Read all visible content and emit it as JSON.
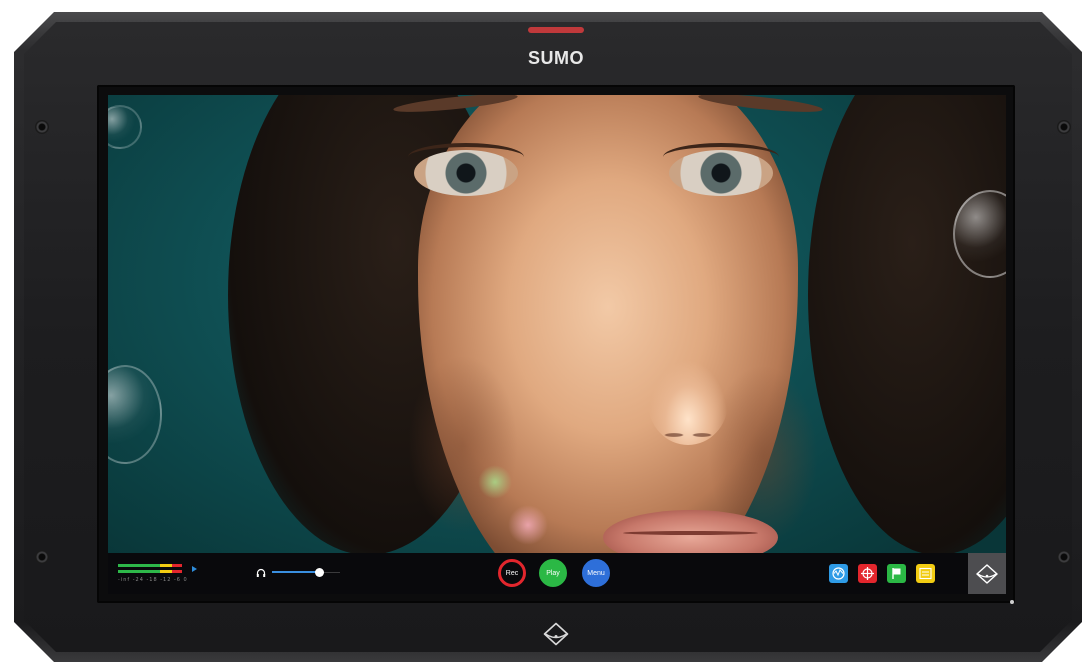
{
  "device": {
    "brand": "SUMO",
    "tally_color": "#c0393b"
  },
  "toolbar": {
    "audio_meter": {
      "levels": [
        0.9,
        0.85
      ],
      "scale_label": "-inf -24 -18 -12 -6 0"
    },
    "headphone_volume": 0.7,
    "rec_label": "Rec",
    "play_label": "Play",
    "menu_label": "Menu",
    "tools": [
      {
        "icon": "waveform-icon",
        "color": "#2e9be6"
      },
      {
        "icon": "crosshair-icon",
        "color": "#e3262d"
      },
      {
        "icon": "flag-icon",
        "color": "#2bb845"
      },
      {
        "icon": "list-icon",
        "color": "#f2cc12"
      }
    ],
    "colors": {
      "rec": "#e3262d",
      "play": "#2bb845",
      "menu": "#2e6fd9"
    }
  }
}
